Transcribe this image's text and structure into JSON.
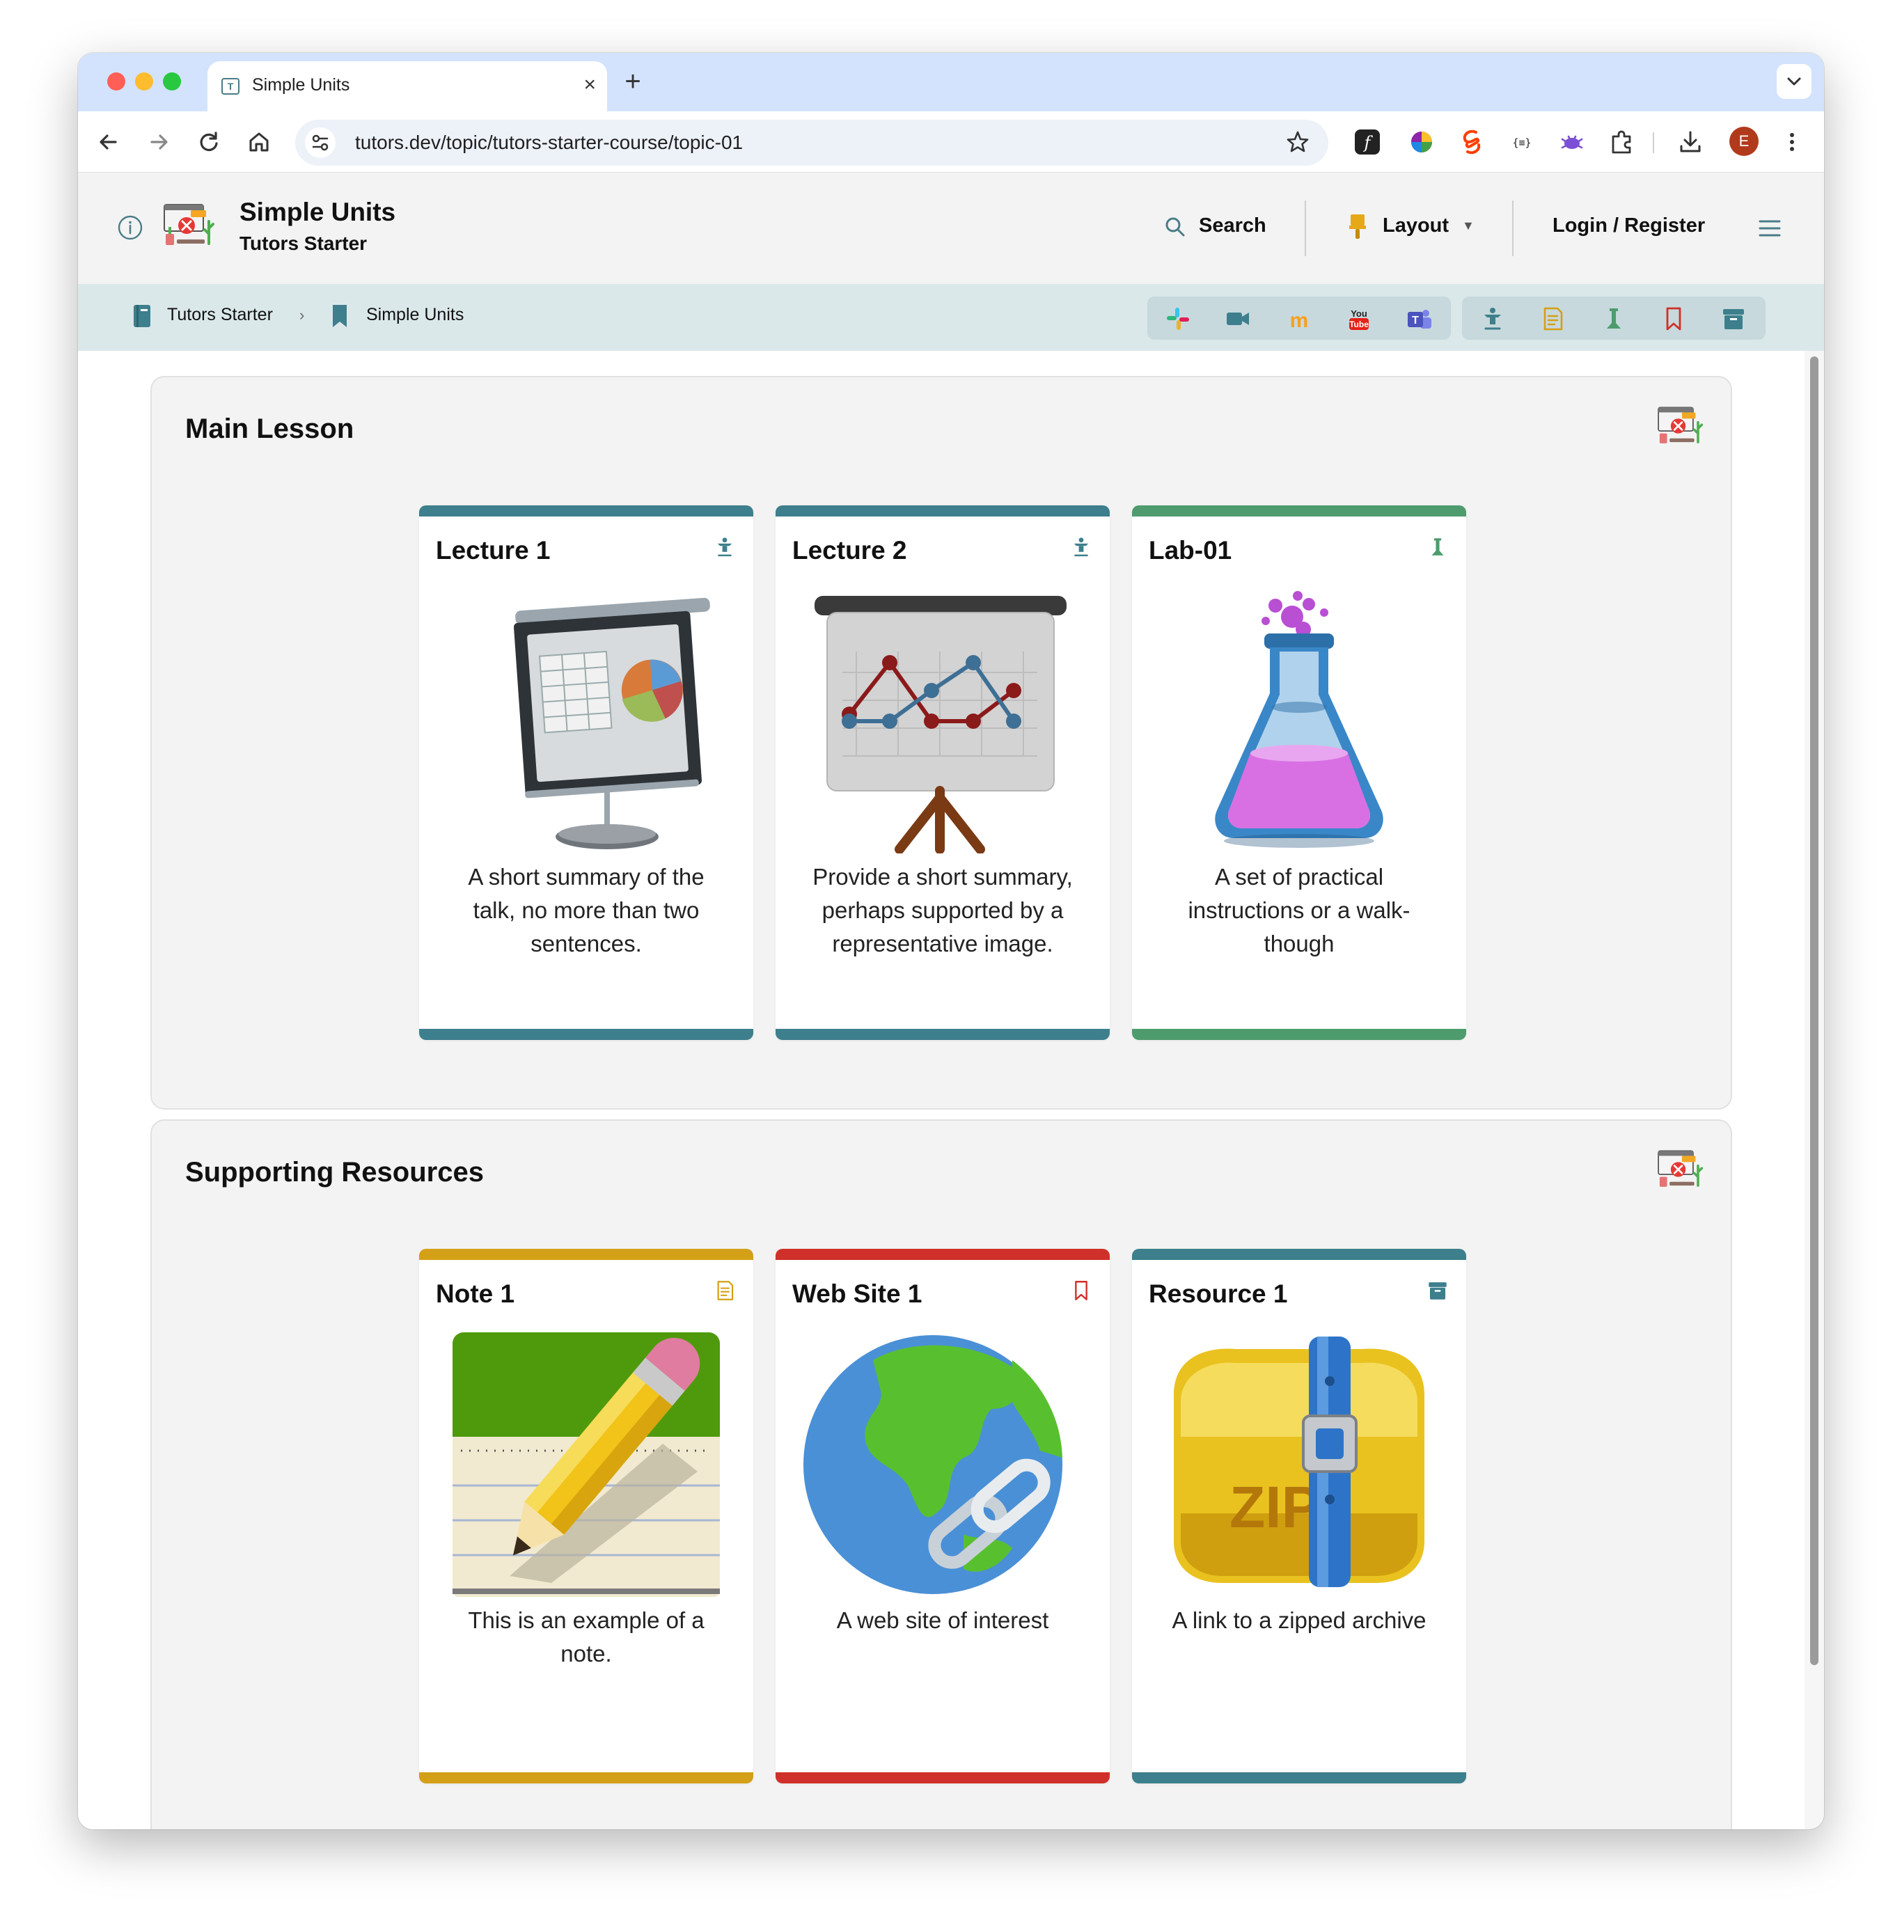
{
  "browser": {
    "tab_title": "Simple Units",
    "tab_favicon_letter": "T",
    "url": "tutors.dev/topic/tutors-starter-course/topic-01",
    "profile_initial": "E"
  },
  "header": {
    "title": "Simple Units",
    "subtitle": "Tutors Starter",
    "search_label": "Search",
    "layout_label": "Layout",
    "login_label": "Login / Register"
  },
  "breadcrumb": {
    "items": [
      {
        "label": "Tutors Starter"
      },
      {
        "label": "Simple Units"
      }
    ],
    "separator": "›"
  },
  "companions": [
    "slack-icon",
    "video-icon",
    "moodle-icon",
    "youtube-icon",
    "teams-icon"
  ],
  "type_filters": [
    "lecture-icon",
    "note-icon",
    "lab-icon",
    "website-icon",
    "archive-icon"
  ],
  "colors": {
    "lecture": "#3d7f8c",
    "lab": "#4e9c6e",
    "note": "#d4a017",
    "web": "#d0302a",
    "archive": "#3d7f8c"
  },
  "sections": [
    {
      "title": "Main Lesson",
      "cards": [
        {
          "title": "Lecture 1",
          "desc": "A short summary of the talk, no more than two sentences.",
          "kind": "lecture",
          "image": "projector-screen-image"
        },
        {
          "title": "Lecture 2",
          "desc": "Provide a short summary, perhaps supported by a representative image.",
          "kind": "lecture",
          "image": "line-chart-board-image"
        },
        {
          "title": "Lab-01",
          "desc": "A set of practical instructions or a walk-though",
          "kind": "lab",
          "image": "chemistry-flask-image"
        }
      ]
    },
    {
      "title": "Supporting Resources",
      "cards": [
        {
          "title": "Note 1",
          "desc": "This is an example of a note.",
          "kind": "note",
          "image": "pencil-notepad-image"
        },
        {
          "title": "Web Site 1",
          "desc": "A web site of interest",
          "kind": "web",
          "image": "globe-link-image"
        },
        {
          "title": "Resource 1",
          "desc": "A link to a zipped archive",
          "kind": "archive",
          "image": "zip-archive-image"
        }
      ]
    }
  ]
}
